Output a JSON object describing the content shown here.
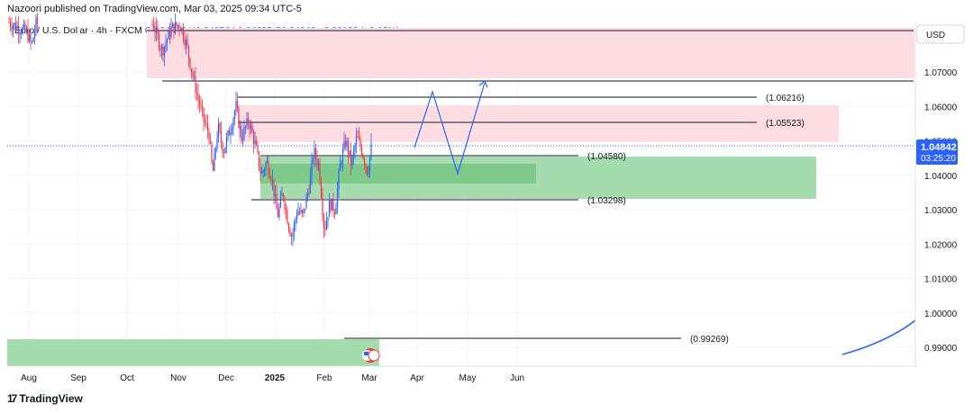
{
  "header": {
    "publisher": "Nazoori published on TradingView.com, Mar 03, 2025 09:34 UTC-5"
  },
  "symbol": {
    "title": "Euro / U.S. Dollar · 4h · FXCM",
    "ohlc": "O1.04716 H1.04856 L1.04685 C1.04842 +0.00126 (+0.12%)"
  },
  "currency_button": "USD",
  "price_tag": {
    "value": "1.04842",
    "countdown": "03:25:20"
  },
  "footer": {
    "brand": "TradingView",
    "logo": "17"
  },
  "colors": {
    "up": "#2962ff",
    "down": "#f23645",
    "supply": "#fddde1",
    "demand": "#a5dcae",
    "demand_dark": "#7fc98a",
    "path": "#2962ff"
  },
  "chart_data": {
    "type": "candlestick",
    "ylim": [
      0.9845,
      1.0845
    ],
    "y_ticks": [
      "1.07000",
      "1.06000",
      "1.05000",
      "1.04000",
      "1.03000",
      "1.02000",
      "1.01000",
      "1.00000",
      "0.99000"
    ],
    "x_ticks": [
      "Aug",
      "Sep",
      "Oct",
      "Nov",
      "Dec",
      "2025",
      "Feb",
      "Mar",
      "Apr",
      "May",
      "Jun"
    ],
    "levels": [
      {
        "label": "(1.06216)",
        "value": 1.06216
      },
      {
        "label": "(1.05523)",
        "value": 1.05523
      },
      {
        "label": "(1.04580)",
        "value": 1.0458
      },
      {
        "label": "(1.03298)",
        "value": 1.03298
      },
      {
        "label": "(0.99269)",
        "value": 0.99269
      }
    ],
    "zones": [
      {
        "type": "supply",
        "top": 1.0835,
        "bottom": 1.0685
      },
      {
        "type": "supply",
        "top": 1.0605,
        "bottom": 1.0485
      },
      {
        "type": "demand",
        "top": 1.0458,
        "bottom": 1.0333
      },
      {
        "type": "demand-inner",
        "top": 1.0438,
        "bottom": 1.0382
      },
      {
        "type": "demand",
        "top": 0.992,
        "bottom": 0.9845
      }
    ],
    "current_price": 1.04842,
    "projection": [
      1.0475,
      1.0645,
      1.041,
      1.0675
    ]
  }
}
